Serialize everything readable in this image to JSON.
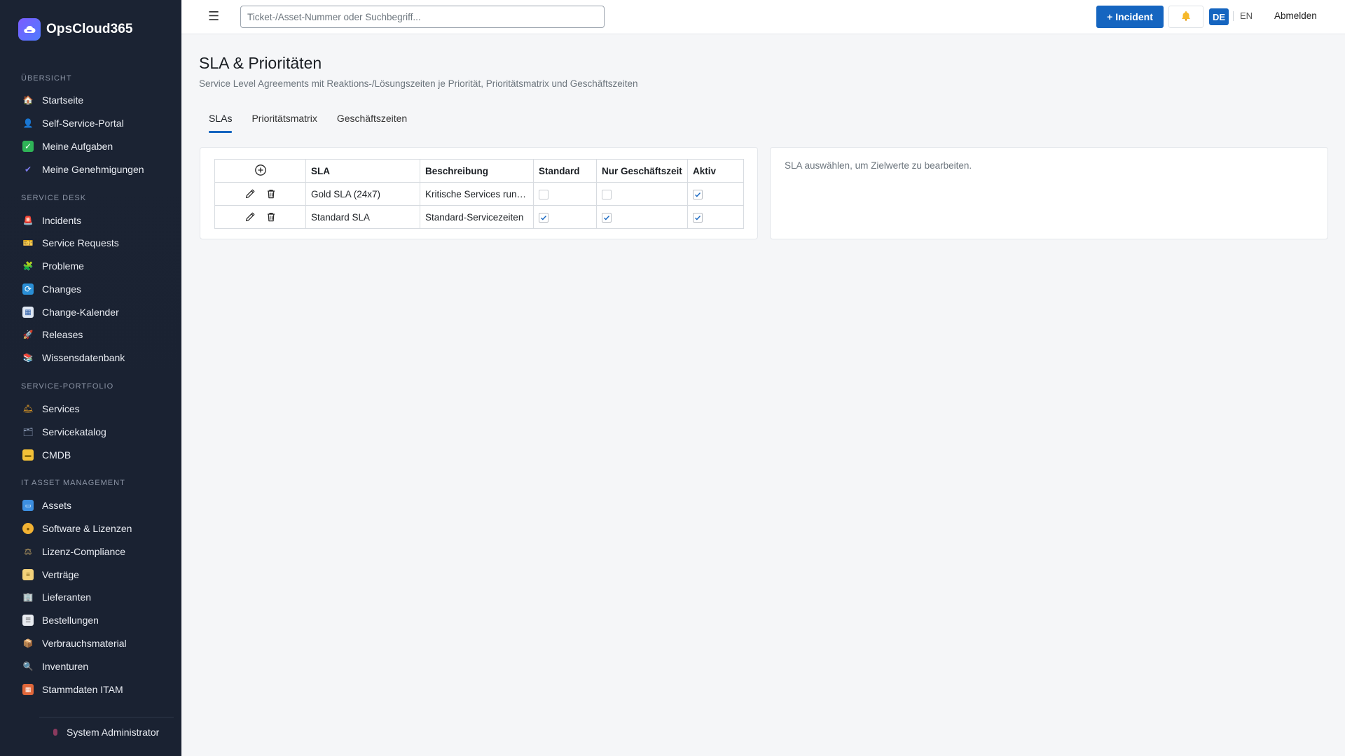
{
  "app": {
    "brand": "OpsCloud365"
  },
  "sidebar": {
    "sections": [
      {
        "label": "ÜBERSICHT"
      },
      {
        "label": "SERVICE DESK"
      },
      {
        "label": "SERVICE-PORTFOLIO"
      },
      {
        "label": "IT ASSET MANAGEMENT"
      }
    ],
    "items": [
      {
        "label": "Startseite",
        "icon": "house-icon"
      },
      {
        "label": "Self-Service-Portal",
        "icon": "person-icon"
      },
      {
        "label": "Meine Aufgaben",
        "icon": "checkbox-icon"
      },
      {
        "label": "Meine Genehmigungen",
        "icon": "checkmark-icon"
      },
      {
        "label": "Incidents",
        "icon": "siren-icon"
      },
      {
        "label": "Service Requests",
        "icon": "ticket-icon"
      },
      {
        "label": "Probleme",
        "icon": "puzzle-icon"
      },
      {
        "label": "Changes",
        "icon": "cycle-icon"
      },
      {
        "label": "Change-Kalender",
        "icon": "calendar-icon"
      },
      {
        "label": "Releases",
        "icon": "rocket-icon"
      },
      {
        "label": "Wissensdatenbank",
        "icon": "books-icon"
      },
      {
        "label": "Services",
        "icon": "bell-service-icon"
      },
      {
        "label": "Servicekatalog",
        "icon": "catalog-icon"
      },
      {
        "label": "CMDB",
        "icon": "folder-icon"
      },
      {
        "label": "Assets",
        "icon": "laptop-icon"
      },
      {
        "label": "Software & Lizenzen",
        "icon": "disc-icon"
      },
      {
        "label": "Lizenz-Compliance",
        "icon": "scales-icon"
      },
      {
        "label": "Verträge",
        "icon": "scroll-icon"
      },
      {
        "label": "Lieferanten",
        "icon": "building-icon"
      },
      {
        "label": "Bestellungen",
        "icon": "receipt-icon"
      },
      {
        "label": "Verbrauchsmaterial",
        "icon": "package-icon"
      },
      {
        "label": "Inventuren",
        "icon": "magnifier-icon"
      },
      {
        "label": "Stammdaten ITAM",
        "icon": "bricks-icon"
      }
    ],
    "user": "System Administrator"
  },
  "topbar": {
    "search_placeholder": "Ticket-/Asset-Nummer oder Suchbegriff...",
    "incident_button": "+ Incident",
    "lang_de": "DE",
    "lang_en": "EN",
    "logout": "Abmelden"
  },
  "page": {
    "title": "SLA & Prioritäten",
    "subtitle": "Service Level Agreements mit Reaktions-/Lösungszeiten je Priorität, Prioritätsmatrix und Geschäftszeiten",
    "tabs": [
      {
        "label": "SLAs",
        "active": true
      },
      {
        "label": "Prioritätsmatrix",
        "active": false
      },
      {
        "label": "Geschäftszeiten",
        "active": false
      }
    ],
    "table": {
      "headers": [
        "SLA",
        "Beschreibung",
        "Standard",
        "Nur Geschäftszeit",
        "Aktiv"
      ],
      "rows": [
        {
          "sla": "Gold SLA (24x7)",
          "description": "Kritische Services rund um die Uhr",
          "standard": false,
          "business_hours_only": false,
          "active": true
        },
        {
          "sla": "Standard SLA",
          "description": "Standard-Servicezeiten",
          "standard": true,
          "business_hours_only": true,
          "active": true
        }
      ]
    },
    "detail_hint": "SLA auswählen, um Zielwerte zu bearbeiten."
  },
  "colors": {
    "sidebar_bg": "#1b2333",
    "accent": "#1565c0",
    "background": "#f5f6f8"
  }
}
